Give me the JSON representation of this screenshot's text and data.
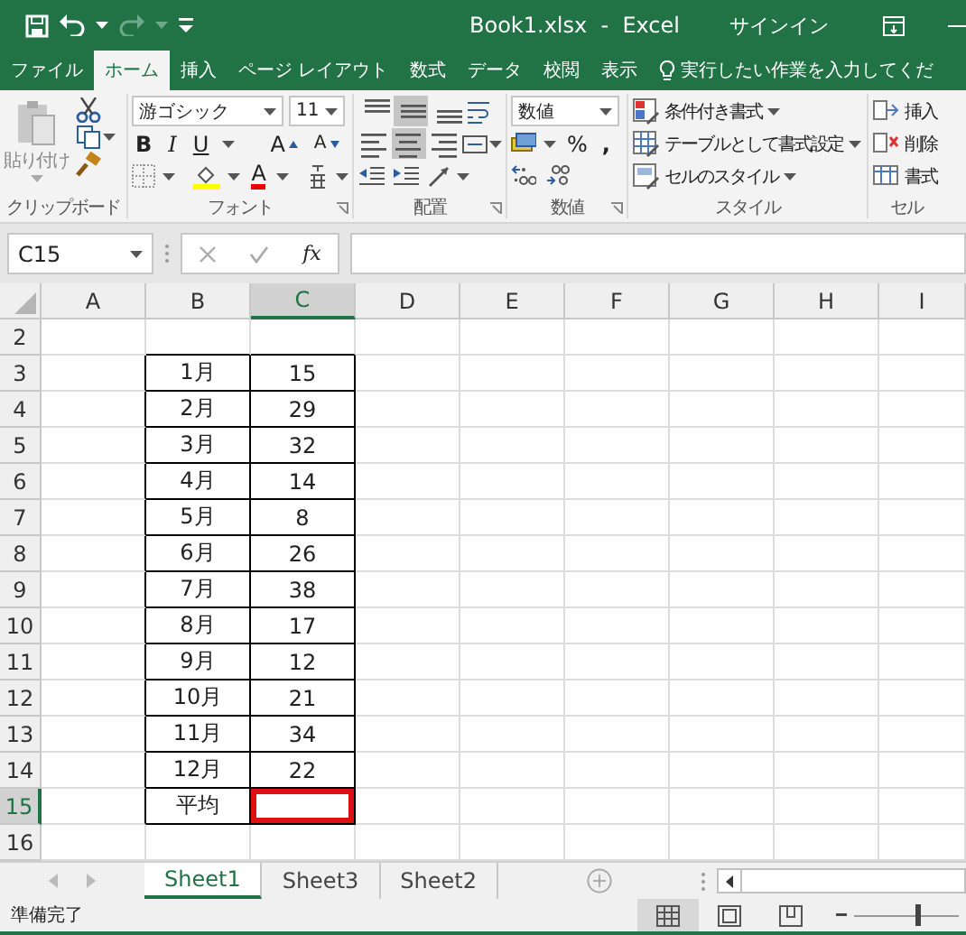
{
  "title_bar": {
    "title": "Book1.xlsx  -  Excel",
    "sign_in": "サインイン"
  },
  "tabs": [
    {
      "label": "ファイル",
      "selected": false
    },
    {
      "label": "ホーム",
      "selected": true
    },
    {
      "label": "挿入",
      "selected": false
    },
    {
      "label": "ページ レイアウト",
      "selected": false
    },
    {
      "label": "数式",
      "selected": false
    },
    {
      "label": "データ",
      "selected": false
    },
    {
      "label": "校閲",
      "selected": false
    },
    {
      "label": "表示",
      "selected": false
    }
  ],
  "tell_me": "実行したい作業を入力してくだ",
  "ribbon": {
    "clipboard": {
      "paste": "貼り付け",
      "label": "クリップボード"
    },
    "font": {
      "name": "游ゴシック",
      "size": "11",
      "bold": "B",
      "italic": "I",
      "underline": "U",
      "grow": "A",
      "shrink": "A",
      "font_color_label": "A",
      "label": "フォント"
    },
    "alignment": {
      "label": "配置",
      "buttons": [
        {
          "kind": "top",
          "selected": false
        },
        {
          "kind": "middle",
          "selected": true
        },
        {
          "kind": "bottom",
          "selected": false
        },
        {
          "kind": "left",
          "selected": false
        },
        {
          "kind": "center",
          "selected": true
        },
        {
          "kind": "right",
          "selected": false
        }
      ]
    },
    "number": {
      "format": "数値",
      "percent": "%",
      "comma": ",",
      "label": "数値"
    },
    "styles": {
      "label": "スタイル",
      "items": [
        {
          "kind": "conditional",
          "label": "条件付き書式"
        },
        {
          "kind": "table",
          "label": "テーブルとして書式設定"
        },
        {
          "kind": "cell",
          "label": "セルのスタイル"
        }
      ]
    },
    "cells": {
      "label": "セル",
      "items": [
        {
          "kind": "insert",
          "label": "挿入"
        },
        {
          "kind": "delete",
          "label": "削除"
        },
        {
          "kind": "format",
          "label": "書式"
        }
      ]
    }
  },
  "formula_bar": {
    "name_box": "C15",
    "function": "fx"
  },
  "columns": [
    {
      "label": "A",
      "selected": false
    },
    {
      "label": "B",
      "selected": false
    },
    {
      "label": "C",
      "selected": true
    },
    {
      "label": "D",
      "selected": false
    },
    {
      "label": "E",
      "selected": false
    },
    {
      "label": "F",
      "selected": false
    },
    {
      "label": "G",
      "selected": false
    },
    {
      "label": "H",
      "selected": false
    },
    {
      "label": "I",
      "selected": false
    }
  ],
  "rows": [
    {
      "number": "2",
      "selected": false
    },
    {
      "number": "3",
      "selected": false,
      "month": "1月",
      "value": "15"
    },
    {
      "number": "4",
      "selected": false,
      "month": "2月",
      "value": "29"
    },
    {
      "number": "5",
      "selected": false,
      "month": "3月",
      "value": "32"
    },
    {
      "number": "6",
      "selected": false,
      "month": "4月",
      "value": "14"
    },
    {
      "number": "7",
      "selected": false,
      "month": "5月",
      "value": "8"
    },
    {
      "number": "8",
      "selected": false,
      "month": "6月",
      "value": "26"
    },
    {
      "number": "9",
      "selected": false,
      "month": "7月",
      "value": "38"
    },
    {
      "number": "10",
      "selected": false,
      "month": "8月",
      "value": "17"
    },
    {
      "number": "11",
      "selected": false,
      "month": "9月",
      "value": "12"
    },
    {
      "number": "12",
      "selected": false,
      "month": "10月",
      "value": "21"
    },
    {
      "number": "13",
      "selected": false,
      "month": "11月",
      "value": "34"
    },
    {
      "number": "14",
      "selected": false,
      "month": "12月",
      "value": "22"
    },
    {
      "number": "15",
      "selected": true,
      "month": "平均"
    },
    {
      "number": "16",
      "selected": false
    }
  ],
  "sheets": [
    {
      "label": "Sheet1",
      "selected": true
    },
    {
      "label": "Sheet3",
      "selected": false
    },
    {
      "label": "Sheet2",
      "selected": false
    }
  ],
  "status": "準備完了",
  "views": [
    {
      "kind": "normal",
      "selected": true
    },
    {
      "kind": "page_layout",
      "selected": false
    },
    {
      "kind": "page_break",
      "selected": false
    }
  ],
  "zoom": {
    "level": 0.6
  }
}
